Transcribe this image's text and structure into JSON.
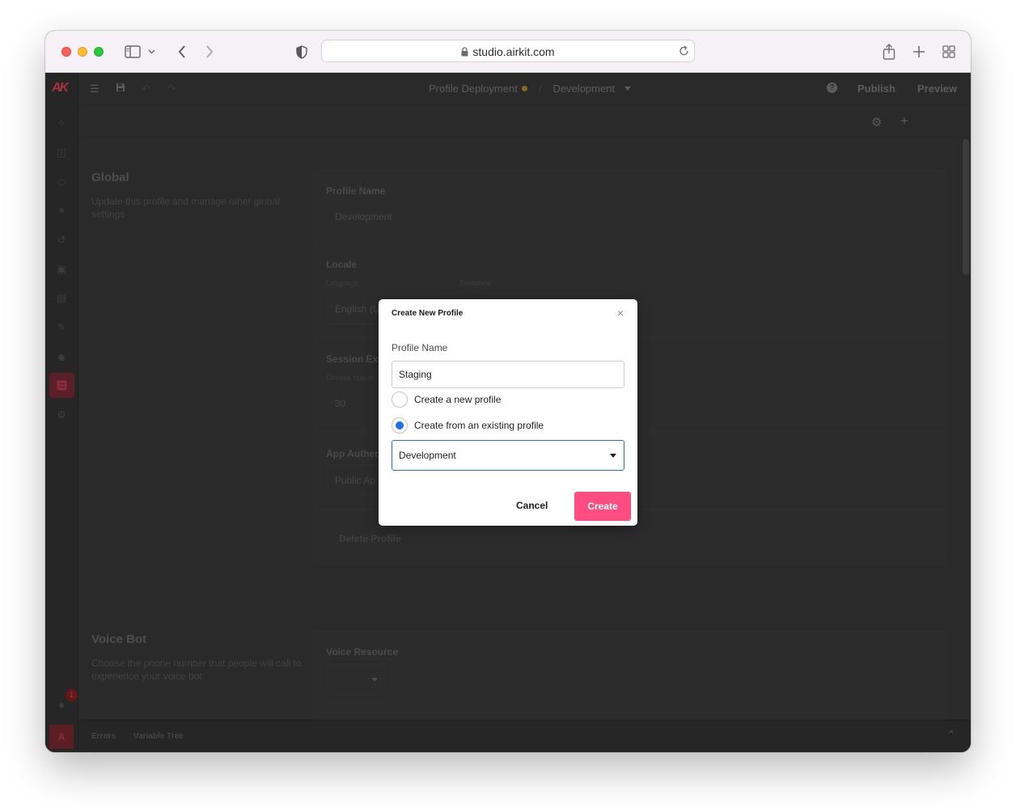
{
  "browser": {
    "url": "studio.airkit.com",
    "icons": [
      "sidebar-icon",
      "chevron-down-icon",
      "back-icon",
      "forward-icon",
      "shield-icon",
      "lock-icon",
      "reload-icon",
      "share-icon",
      "new-tab-icon",
      "tab-overview-icon"
    ]
  },
  "app": {
    "logo": "AK",
    "header": {
      "app_name": "Profile Deployment",
      "profile": "Development",
      "help": "?",
      "publish": "Publish",
      "preview": "Preview"
    },
    "sections": {
      "global": {
        "title": "Global",
        "description": "Update this profile and manage other global settings"
      },
      "voice": {
        "title": "Voice Bot",
        "description": "Choose the phone number that people will call to experience your voice bot"
      }
    },
    "fields": {
      "profile_name_label": "Profile Name",
      "profile_name_value": "Development",
      "locale_label": "Locale",
      "language_label": "Language",
      "language_value": "English (U",
      "timezone_label": "Timezone",
      "session_label": "Session Ex",
      "session_desc": "Choose how lo",
      "session_value": "30",
      "auth_label": "App Authen",
      "auth_value": "Public Ap",
      "delete_label": "Delete Profile",
      "voice_resource_label": "Voice Resource"
    },
    "bottom": {
      "errors_tab": "Errors",
      "variable_tree_tab": "Variable Tree",
      "badge_count": "1",
      "avatar": "A"
    }
  },
  "modal": {
    "title": "Create New Profile",
    "close": "×",
    "profile_name_label": "Profile Name",
    "profile_name_value": "Staging",
    "options": [
      {
        "label": "Create a new profile",
        "selected": false
      },
      {
        "label": "Create from an existing profile",
        "selected": true
      }
    ],
    "source_profile": "Development",
    "cancel": "Cancel",
    "create": "Create"
  },
  "colors": {
    "accent_pink": "#ff4d82",
    "radio_blue": "#1a73e8",
    "dim_background": "#2a2a2a"
  }
}
